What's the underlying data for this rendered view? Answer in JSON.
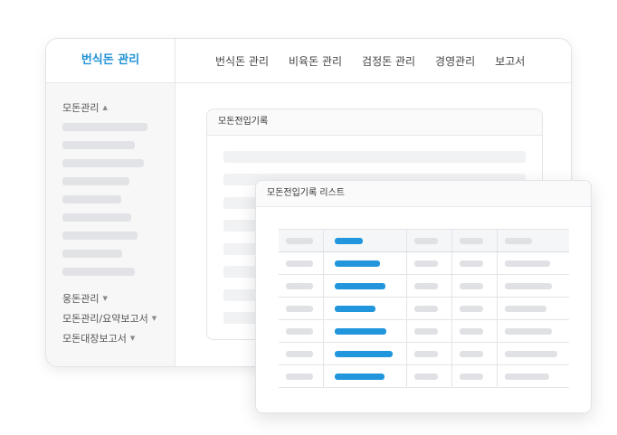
{
  "app": {
    "brand": "번식돈 관리",
    "accent_color": "#2393d6",
    "bar_blue": "#2196dd"
  },
  "topnav": {
    "items": [
      "번식돈 관리",
      "비육돈 관리",
      "검정돈 관리",
      "경영관리",
      "보고서"
    ]
  },
  "sidebar": {
    "sections": [
      {
        "label": "모돈관리",
        "arrow": "▲",
        "expanded": true
      },
      {
        "label": "웅돈관리",
        "arrow": "▼",
        "expanded": false
      },
      {
        "label": "모돈관리/요약보고서",
        "arrow": "▼",
        "expanded": false
      },
      {
        "label": "모돈대장보고서",
        "arrow": "▼",
        "expanded": false
      }
    ],
    "placeholder_item_count": 9
  },
  "form_card": {
    "title": "모돈전입기록",
    "placeholder_row_count": 8
  },
  "list_card": {
    "title": "모돈전입기록 리스트",
    "columns": 5,
    "rows": 7
  }
}
